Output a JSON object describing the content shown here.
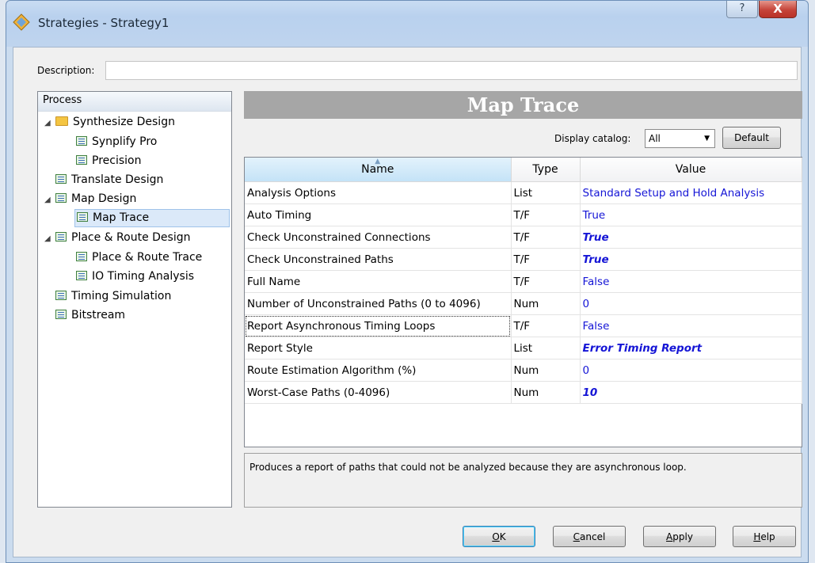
{
  "window": {
    "title": "Strategies - Strategy1",
    "help_glyph": "?",
    "close_glyph": "X"
  },
  "description": {
    "label": "Description:",
    "value": ""
  },
  "process": {
    "header": "Process",
    "items": [
      {
        "label": "Synthesize Design",
        "expanded": true,
        "icon": "folder-icon"
      },
      {
        "label": "Synplify Pro",
        "icon": "task-icon"
      },
      {
        "label": "Precision",
        "icon": "task-icon"
      },
      {
        "label": "Translate Design",
        "icon": "task-icon"
      },
      {
        "label": "Map Design",
        "expanded": true,
        "icon": "task-icon"
      },
      {
        "label": "Map Trace",
        "selected": true,
        "icon": "task-icon"
      },
      {
        "label": "Place & Route Design",
        "expanded": true,
        "icon": "task-icon"
      },
      {
        "label": "Place & Route Trace",
        "icon": "task-icon"
      },
      {
        "label": "IO Timing Analysis",
        "icon": "task-icon"
      },
      {
        "label": "Timing Simulation",
        "icon": "task-icon"
      },
      {
        "label": "Bitstream",
        "icon": "task-icon"
      }
    ]
  },
  "main": {
    "heading": "Map Trace",
    "catalog_label": "Display catalog:",
    "catalog_value": "All",
    "default_button": "Default",
    "columns": [
      "Name",
      "Type",
      "Value"
    ],
    "rows": [
      {
        "name": "Analysis Options",
        "type": "List",
        "value": "Standard Setup and Hold Analysis",
        "bold": false
      },
      {
        "name": "Auto Timing",
        "type": "T/F",
        "value": "True",
        "bold": false
      },
      {
        "name": "Check Unconstrained Connections",
        "type": "T/F",
        "value": "True",
        "bold": true
      },
      {
        "name": "Check Unconstrained Paths",
        "type": "T/F",
        "value": "True",
        "bold": true
      },
      {
        "name": "Full Name",
        "type": "T/F",
        "value": "False",
        "bold": false
      },
      {
        "name": "Number of Unconstrained Paths (0 to 4096)",
        "type": "Num",
        "value": "0",
        "bold": false
      },
      {
        "name": "Report Asynchronous Timing Loops",
        "type": "T/F",
        "value": "False",
        "bold": false,
        "focused": true
      },
      {
        "name": "Report Style",
        "type": "List",
        "value": "Error Timing Report",
        "bold": true
      },
      {
        "name": "Route Estimation Algorithm (%)",
        "type": "Num",
        "value": "0",
        "bold": false
      },
      {
        "name": "Worst-Case Paths (0-4096)",
        "type": "Num",
        "value": "10",
        "bold": true
      }
    ],
    "help_text": "Produces a report of paths that could not be analyzed because they are asynchronous loop."
  },
  "buttons": {
    "ok_mnemonic": "O",
    "ok_rest": "K",
    "cancel_mnemonic": "C",
    "cancel_rest": "ancel",
    "apply_mnemonic": "A",
    "apply_rest": "pply",
    "help_mnemonic": "H",
    "help_rest": "elp"
  }
}
